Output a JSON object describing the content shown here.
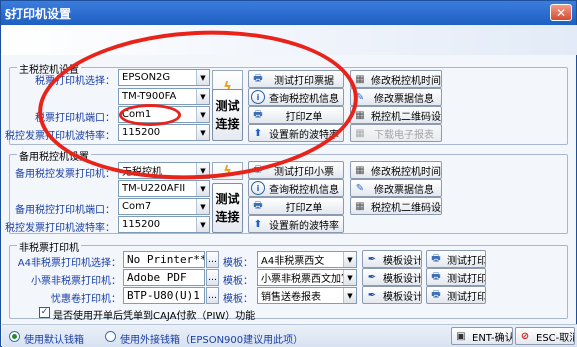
{
  "window": {
    "title": "§打印机设置",
    "close_label": "✕"
  },
  "main_group": {
    "title": "主税控机设置",
    "invoice_printer_label": "税票打印机选择：",
    "invoice_printer_value": "EPSON2G",
    "printer_model_value": "TM-T900FA",
    "port_label": "税票打印机端口：",
    "port_value": "Com1",
    "baud_label": "税控发票打印机波特率：",
    "baud_value": "115200",
    "test_connect": "测试\n连接",
    "buttons": {
      "test_print_invoice": "测试打印票据",
      "modify_time": "修改税控机时间",
      "query_info": "查询税控机信息",
      "modify_data": "修改票据信息",
      "print_z": "打印Z单",
      "qr_setting": "税控机二维码设置",
      "set_baud": "设置新的波特率",
      "download_report": "下载电子报表"
    }
  },
  "backup_group": {
    "title": "备用税控机设置",
    "invoice_printer_label": "备用税控发票打印机：",
    "invoice_printer_value": "无税控机",
    "printer_model_value": "TM-U220AFII",
    "port_label": "备用税控打印机端口：",
    "port_value": "Com7",
    "baud_label": "税控发票打印机波特率：",
    "baud_value": "115200",
    "test_connect": "测试\n连接",
    "buttons": {
      "test_print_small": "测试打印小票",
      "modify_time": "修改税控机时间",
      "query_info": "查询税控机信息",
      "modify_data": "修改票据信息",
      "print_z": "打印Z单",
      "qr_setting": "税控机二维码设置",
      "set_baud": "设置新的波特率"
    }
  },
  "nontax_group": {
    "title": "非税票打印机",
    "rows": [
      {
        "label": "A4非税票打印机选择：",
        "printer": "No Printer**",
        "template_label": "模板：",
        "template": "A4非税票西文",
        "design": "模板设计",
        "test": "测试打印"
      },
      {
        "label": "小票非税票打印机：",
        "printer": "Adobe PDF",
        "template_label": "模板：",
        "template": "小票非税票西文加宽",
        "design": "模板设计",
        "test": "测试打印"
      },
      {
        "label": "忧惠卷打印机：",
        "printer": "BTP-U80(U)1",
        "template_label": "模板：",
        "template": "销售送卷报表",
        "design": "模板设计",
        "test": "测试打印"
      }
    ],
    "checkbox_label": "是否使用开单后凭单到CAJA付款（PIW）功能"
  },
  "footer": {
    "radio_default": "使用默认钱箱",
    "radio_external": "使用外接钱箱（EPSON900建议用此项）",
    "ok_label": "ENT-确认",
    "cancel_label": "ESC-取消"
  },
  "colors": {
    "title_bar": "#1e5fc2",
    "label_blue": "#1a3fa6",
    "annotation_red": "#e8231a"
  }
}
